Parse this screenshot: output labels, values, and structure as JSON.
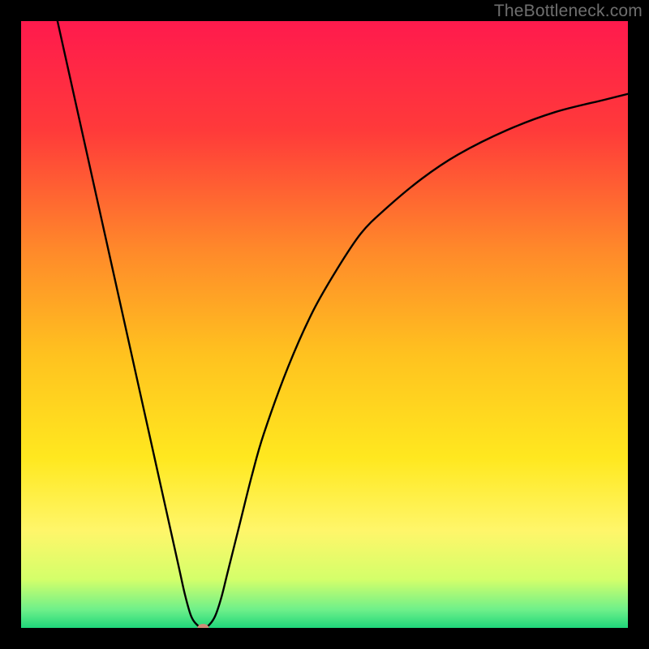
{
  "watermark": "TheBottleneck.com",
  "chart_data": {
    "type": "line",
    "title": "",
    "xlabel": "",
    "ylabel": "",
    "xlim": [
      0,
      100
    ],
    "ylim": [
      0,
      100
    ],
    "grid": false,
    "legend": false,
    "background_gradient": {
      "stops": [
        {
          "offset": 0.0,
          "color": "#ff1a4d"
        },
        {
          "offset": 0.18,
          "color": "#ff3a3a"
        },
        {
          "offset": 0.38,
          "color": "#ff8a2a"
        },
        {
          "offset": 0.55,
          "color": "#ffc21f"
        },
        {
          "offset": 0.72,
          "color": "#ffe81f"
        },
        {
          "offset": 0.84,
          "color": "#fff66a"
        },
        {
          "offset": 0.92,
          "color": "#d4ff6a"
        },
        {
          "offset": 0.97,
          "color": "#6ef08a"
        },
        {
          "offset": 1.0,
          "color": "#1fd67a"
        }
      ]
    },
    "series": [
      {
        "name": "bottleneck-curve",
        "color": "#000000",
        "x": [
          6,
          8,
          10,
          12,
          14,
          16,
          18,
          20,
          22,
          24,
          26,
          27,
          28,
          29,
          30,
          31,
          32,
          33,
          34,
          36,
          38,
          40,
          44,
          48,
          52,
          56,
          60,
          66,
          72,
          80,
          88,
          96,
          100
        ],
        "y": [
          100,
          91,
          82,
          73,
          64,
          55,
          46,
          37,
          28,
          19,
          10,
          5.5,
          2,
          0.5,
          0,
          0.5,
          2,
          5,
          9,
          17,
          25,
          32,
          43,
          52,
          59,
          65,
          69,
          74,
          78,
          82,
          85,
          87,
          88
        ]
      }
    ],
    "marker": {
      "name": "optimum-point",
      "x": 30,
      "y": 0,
      "color": "#d08b78",
      "rx": 7,
      "ry": 5
    }
  }
}
